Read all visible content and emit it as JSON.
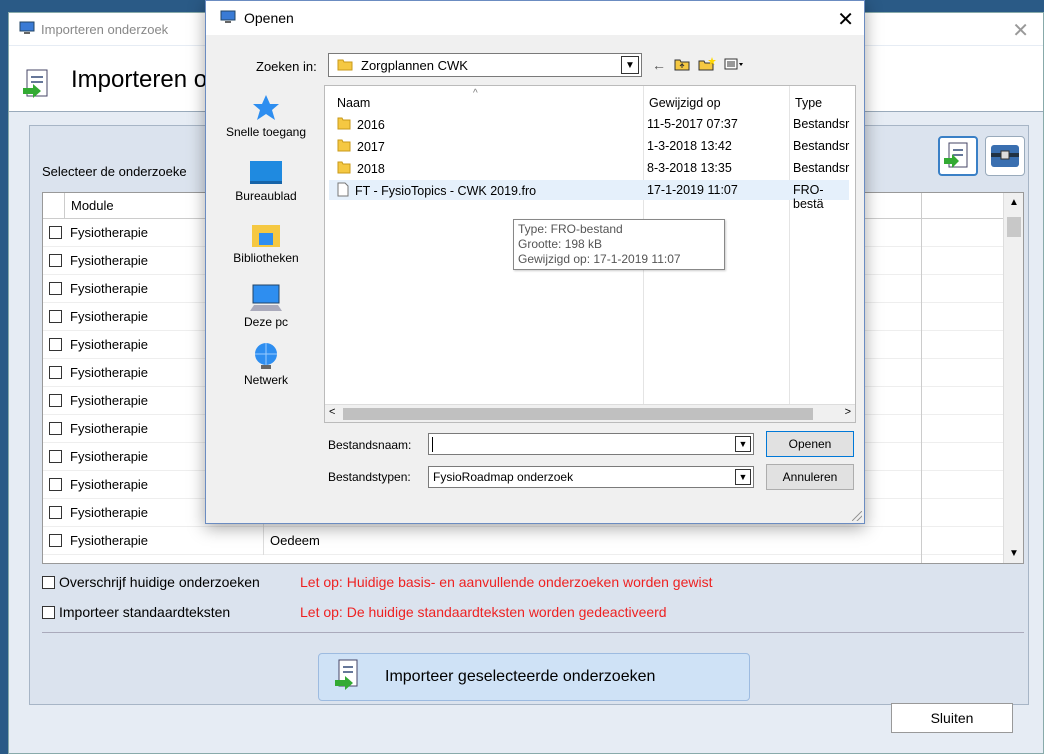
{
  "background_window": {
    "title": "Importeren onderzoek",
    "header_title": "Importeren o",
    "select_label": "Selecteer de onderzoeke",
    "grid": {
      "header_module": "Module",
      "rows": [
        {
          "module": "Fysiotherapie",
          "name": ""
        },
        {
          "module": "Fysiotherapie",
          "name": ""
        },
        {
          "module": "Fysiotherapie",
          "name": ""
        },
        {
          "module": "Fysiotherapie",
          "name": ""
        },
        {
          "module": "Fysiotherapie",
          "name": ""
        },
        {
          "module": "Fysiotherapie",
          "name": ""
        },
        {
          "module": "Fysiotherapie",
          "name": ""
        },
        {
          "module": "Fysiotherapie",
          "name": ""
        },
        {
          "module": "Fysiotherapie",
          "name": ""
        },
        {
          "module": "Fysiotherapie",
          "name": ""
        },
        {
          "module": "Fysiotherapie",
          "name": ""
        },
        {
          "module": "Fysiotherapie",
          "name": "Oedeem"
        }
      ]
    },
    "options": {
      "overwrite_label": "Overschrijf huidige onderzoeken",
      "overwrite_warning": "Let op: Huidige basis- en aanvullende onderzoeken worden gewist",
      "import_std_label": "Importeer standaardteksten",
      "import_std_warning": "Let op: De huidige standaardteksten worden gedeactiveerd"
    },
    "import_button": "Importeer geselecteerde onderzoeken",
    "close_button": "Sluiten"
  },
  "dialog": {
    "title": "Openen",
    "look_in_label": "Zoeken in:",
    "look_in_value": "Zorgplannen CWK",
    "places": [
      "Snelle toegang",
      "Bureaublad",
      "Bibliotheken",
      "Deze pc",
      "Netwerk"
    ],
    "columns": {
      "name": "Naam",
      "modified": "Gewijzigd op",
      "type": "Type"
    },
    "files": [
      {
        "name": "2016",
        "modified": "11-5-2017 07:37",
        "type": "Bestandsr",
        "kind": "folder"
      },
      {
        "name": "2017",
        "modified": "1-3-2018 13:42",
        "type": "Bestandsr",
        "kind": "folder"
      },
      {
        "name": "2018",
        "modified": "8-3-2018 13:35",
        "type": "Bestandsr",
        "kind": "folder"
      },
      {
        "name": "FT - FysioTopics - CWK 2019.fro",
        "modified": "17-1-2019 11:07",
        "type": "FRO-bestä",
        "kind": "file"
      }
    ],
    "tooltip": {
      "type": "Type: FRO-bestand",
      "size": "Grootte: 198 kB",
      "modified": "Gewijzigd op: 17-1-2019 11:07"
    },
    "filename_label": "Bestandsnaam:",
    "filename_value": "",
    "filetype_label": "Bestandstypen:",
    "filetype_value": "FysioRoadmap onderzoek",
    "open_button": "Openen",
    "cancel_button": "Annuleren"
  }
}
